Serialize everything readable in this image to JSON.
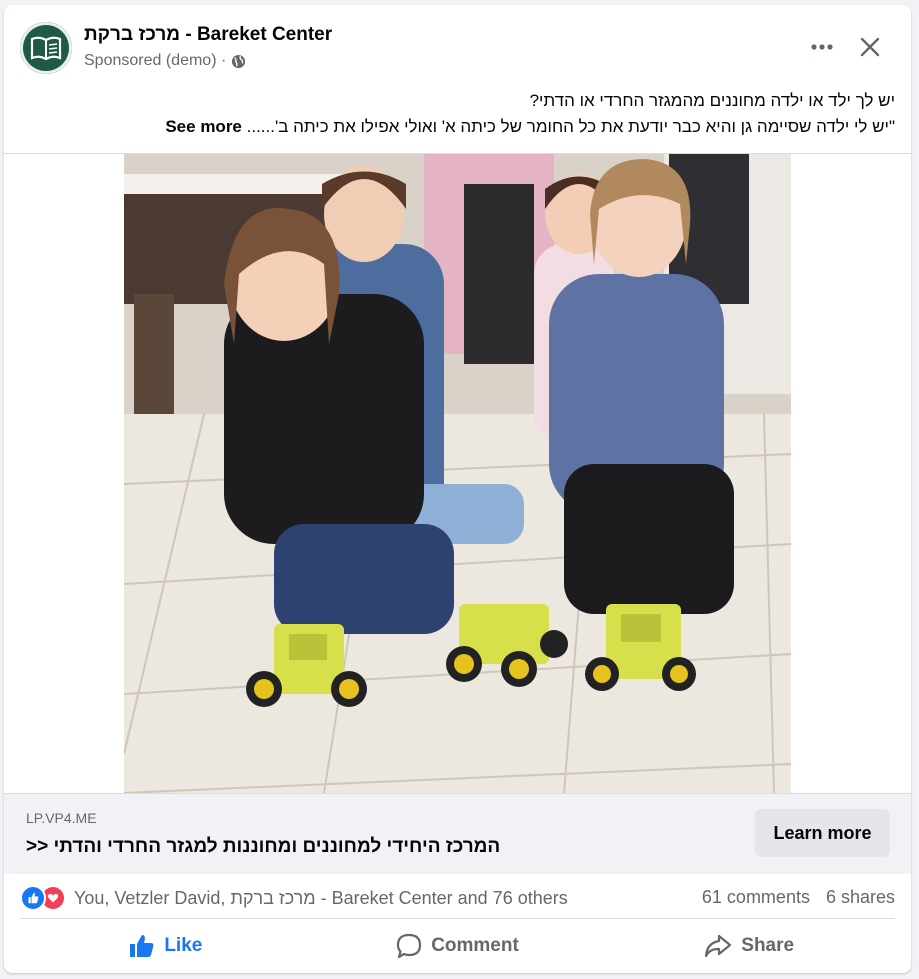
{
  "header": {
    "page_name": "מרכז ברקת - Bareket Center",
    "sponsored": "Sponsored (demo) ·"
  },
  "post": {
    "line1": "יש לך ילד או ילדה מחוננים מהמגזר החרדי או הדתי?",
    "line2": "\"יש לי ילדה שסיימה גן והיא כבר יודעת את כל החומר של כיתה א' ואולי אפילו את כיתה ב'......",
    "see_more": "See more"
  },
  "link": {
    "domain": "LP.VP4.ME",
    "title": "המרכז היחידי למחוננים ומחוננות למגזר החרדי והדתי <<",
    "cta": "Learn more"
  },
  "reactions": {
    "names": "You, Vetzler David, מרכז ברקת - Bareket Center and 76 others",
    "comments": "61 comments",
    "shares": "6 shares",
    "like_color": "#1877f2",
    "love_color": "#f33e58"
  },
  "actions": {
    "like": "Like",
    "comment": "Comment",
    "share": "Share"
  },
  "icons": {
    "avatar": "open-book-icon",
    "more": "more-horizontal-icon",
    "close": "close-icon",
    "audience": "globe-icon"
  }
}
